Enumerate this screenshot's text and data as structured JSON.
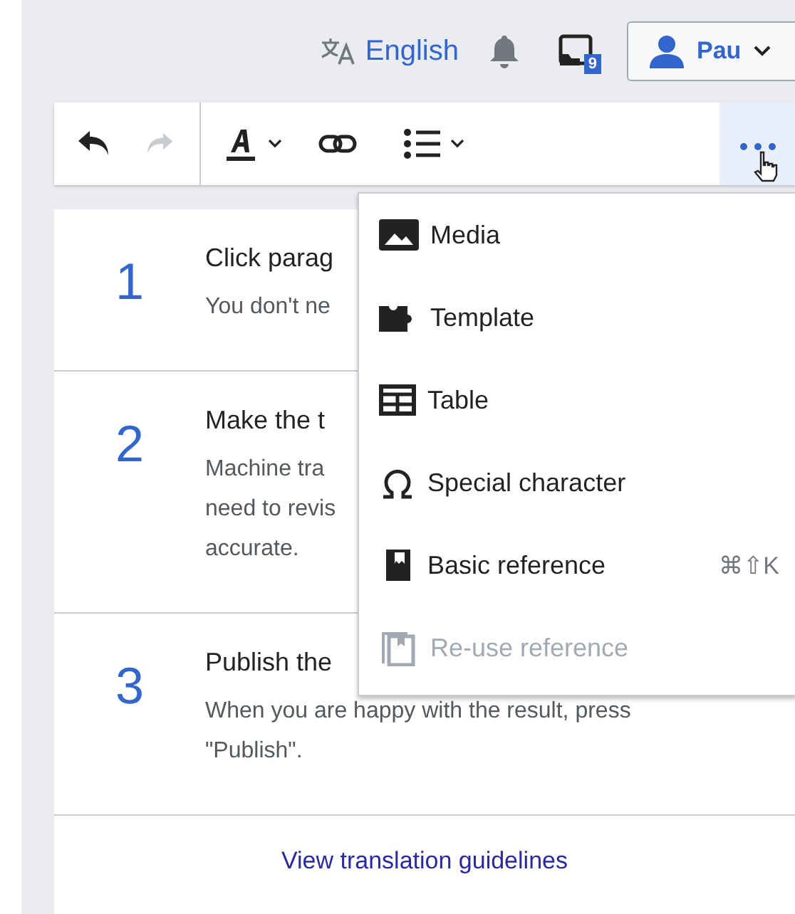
{
  "top_bar": {
    "language": "English",
    "notices_badge": "9",
    "user": "Pau"
  },
  "toolbar": {
    "redo_disabled": true,
    "more_active": true
  },
  "steps": [
    {
      "number": "1",
      "title": "Click parag",
      "lines": [
        "You don't ne"
      ]
    },
    {
      "number": "2",
      "title": "Make the t",
      "lines": [
        "Machine tra",
        "need to revis",
        "accurate."
      ]
    },
    {
      "number": "3",
      "title": "Publish the",
      "lines": [
        "When you are happy with the result, press",
        "\"Publish\"."
      ]
    }
  ],
  "guidelines_link": "View translation guidelines",
  "insert_menu": [
    {
      "kind": "media",
      "label": "Media",
      "disabled": false
    },
    {
      "kind": "template",
      "label": "Template",
      "disabled": false
    },
    {
      "kind": "table",
      "label": "Table",
      "disabled": false
    },
    {
      "kind": "special",
      "label": "Special character",
      "disabled": false
    },
    {
      "kind": "reference",
      "label": "Basic reference",
      "shortcut": "⌘⇧K",
      "disabled": false
    },
    {
      "kind": "reuse",
      "label": "Re-use reference",
      "disabled": true
    }
  ]
}
